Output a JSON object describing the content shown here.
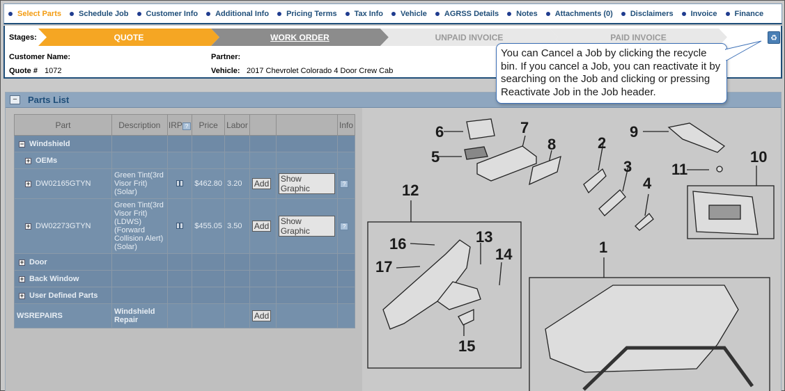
{
  "nav": {
    "items": [
      "Select Parts",
      "Schedule Job",
      "Customer Info",
      "Additional Info",
      "Pricing Terms",
      "Tax Info",
      "Vehicle",
      "AGRSS Details",
      "Notes",
      "Attachments (0)",
      "Disclaimers",
      "Invoice",
      "Finance"
    ],
    "active_index": 0,
    "active_color": "#f39c12"
  },
  "header": {
    "stages_label": "Stages:",
    "stages": [
      "QUOTE",
      "WORK ORDER",
      "UNPAID INVOICE",
      "PAID INVOICE"
    ],
    "customer_name_label": "Customer Name:",
    "customer_name": "",
    "quote_label": "Quote #",
    "quote_value": "1072",
    "partner_label": "Partner:",
    "partner_value": "",
    "vehicle_label": "Vehicle:",
    "vehicle_value": "2017 Chevrolet Colorado 4 Door Crew Cab",
    "recycle_icon": "recycle-bin-icon"
  },
  "tooltip": {
    "text": "You can Cancel a Job by clicking the recycle bin. If you cancel a Job, you can reactivate it by searching on the Job and clicking or pressing Reactivate Job in the Job header."
  },
  "parts_list": {
    "title": "Parts List",
    "columns": [
      "Part",
      "Description",
      "IRP",
      "Price",
      "Labor",
      "",
      "",
      "Info"
    ],
    "groups": {
      "windshield": "Windshield",
      "oems": "OEMs",
      "door": "Door",
      "back_window": "Back Window",
      "user_defined": "User Defined Parts"
    },
    "items": [
      {
        "part": "DW02165GTYN",
        "description": "Green Tint(3rd Visor Frit) (Solar)",
        "price": "$462.80",
        "labor": "3.20",
        "add": "Add",
        "graphic": "Show Graphic"
      },
      {
        "part": "DW02273GTYN",
        "description": "Green Tint(3rd Visor Frit)(LDWS) (Forward Collision Alert) (Solar)",
        "price": "$455.05",
        "labor": "3.50",
        "add": "Add",
        "graphic": "Show Graphic"
      }
    ],
    "repairs": {
      "part": "WSREPAIRS",
      "description": "Windshield Repair",
      "add": "Add"
    }
  },
  "diagram": {
    "callouts": [
      "1",
      "2",
      "3",
      "4",
      "5",
      "6",
      "7",
      "8",
      "9",
      "10",
      "11",
      "12",
      "13",
      "14",
      "15",
      "16",
      "17"
    ]
  }
}
